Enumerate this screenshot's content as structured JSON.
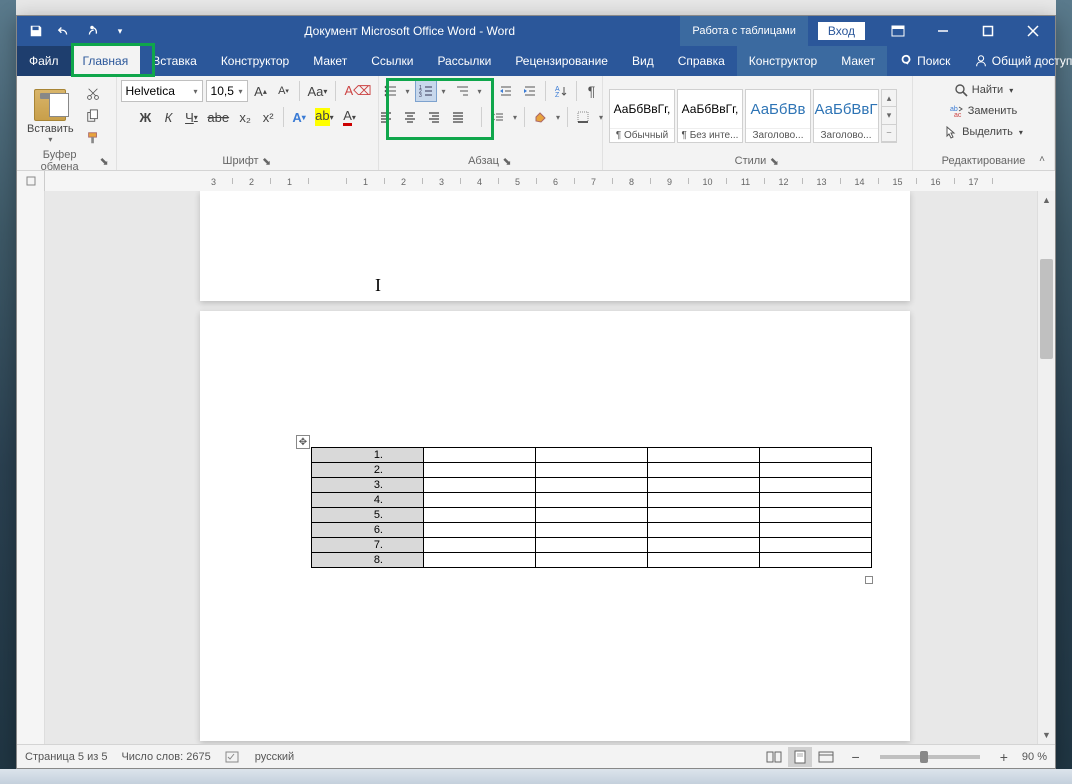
{
  "title": "Документ Microsoft Office Word  -  Word",
  "context_area": "Работа с таблицами",
  "login": "Вход",
  "tabs": {
    "file": "Файл",
    "home": "Главная",
    "insert": "Вставка",
    "design": "Конструктор",
    "layout": "Макет",
    "references": "Ссылки",
    "mailings": "Рассылки",
    "review": "Рецензирование",
    "view": "Вид",
    "help": "Справка",
    "ctx_design": "Конструктор",
    "ctx_layout": "Макет",
    "search": "Поиск",
    "share": "Общий доступ"
  },
  "ribbon": {
    "clipboard": {
      "label": "Буфер обмена",
      "paste": "Вставить"
    },
    "font": {
      "label": "Шрифт",
      "family": "Helvetica",
      "size": "10,5",
      "bold": "Ж",
      "italic": "К",
      "under": "Ч",
      "strike": "abe",
      "sub": "x₂",
      "sup": "x²"
    },
    "paragraph": {
      "label": "Абзац"
    },
    "styles": {
      "label": "Стили",
      "items": [
        {
          "preview": "АаБбВвГг,",
          "name": "¶ Обычный",
          "color": "#000"
        },
        {
          "preview": "АаБбВвГг,",
          "name": "¶ Без инте...",
          "color": "#000"
        },
        {
          "preview": "АаБбВв",
          "name": "Заголово...",
          "color": "#2e74b5"
        },
        {
          "preview": "АаБбВвГ",
          "name": "Заголово...",
          "color": "#2e74b5"
        }
      ]
    },
    "editing": {
      "label": "Редактирование",
      "find": "Найти",
      "replace": "Заменить",
      "select": "Выделить"
    }
  },
  "table_rows": [
    "1.",
    "2.",
    "3.",
    "4.",
    "5.",
    "6.",
    "7.",
    "8."
  ],
  "status": {
    "page": "Страница 5 из 5",
    "words": "Число слов: 2675",
    "lang": "русский",
    "zoom": "90 %"
  }
}
